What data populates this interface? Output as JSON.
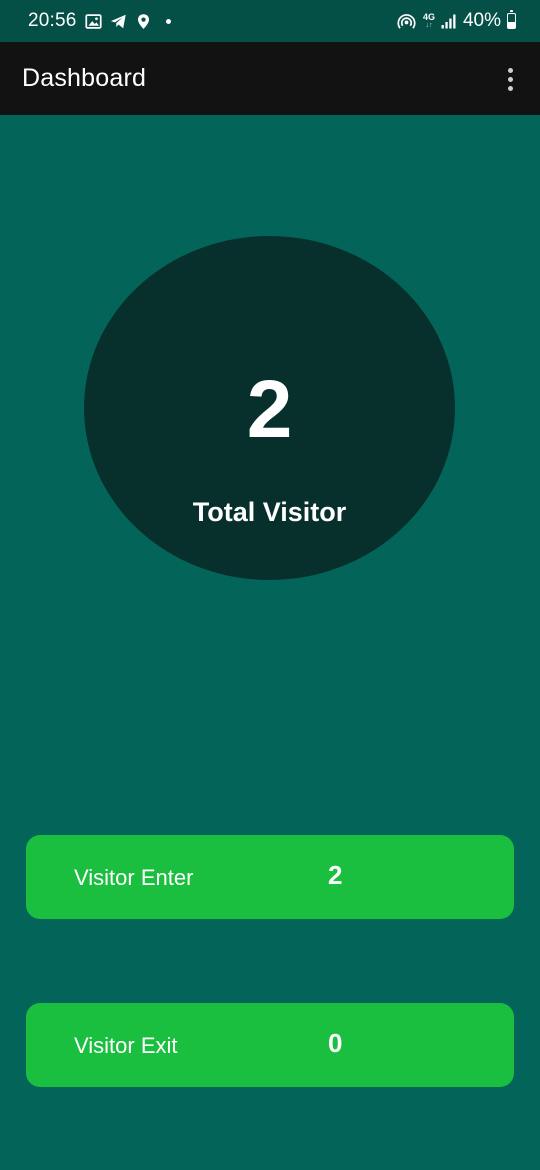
{
  "status_bar": {
    "time": "20:56",
    "icons": [
      "image-icon",
      "telegram-icon",
      "location-icon",
      "notification-dot",
      "hotspot-icon",
      "signal-icon",
      "battery-icon"
    ],
    "network_type": "4G",
    "network_arrows": "↓↑",
    "battery_percent": "40%",
    "battery_level": 0.4
  },
  "app_bar": {
    "title": "Dashboard",
    "menu_icon": "more-vert-icon"
  },
  "summary": {
    "total_count": "2",
    "total_label": "Total Visitor"
  },
  "cards": {
    "enter": {
      "label": "Visitor Enter",
      "value": "2"
    },
    "exit": {
      "label": "Visitor Exit",
      "value": "0"
    }
  },
  "colors": {
    "background": "#03655a",
    "status_bar": "#044f46",
    "app_bar": "#121212",
    "circle": "#072f2c",
    "card": "#1abf3f",
    "text": "#ffffff"
  }
}
